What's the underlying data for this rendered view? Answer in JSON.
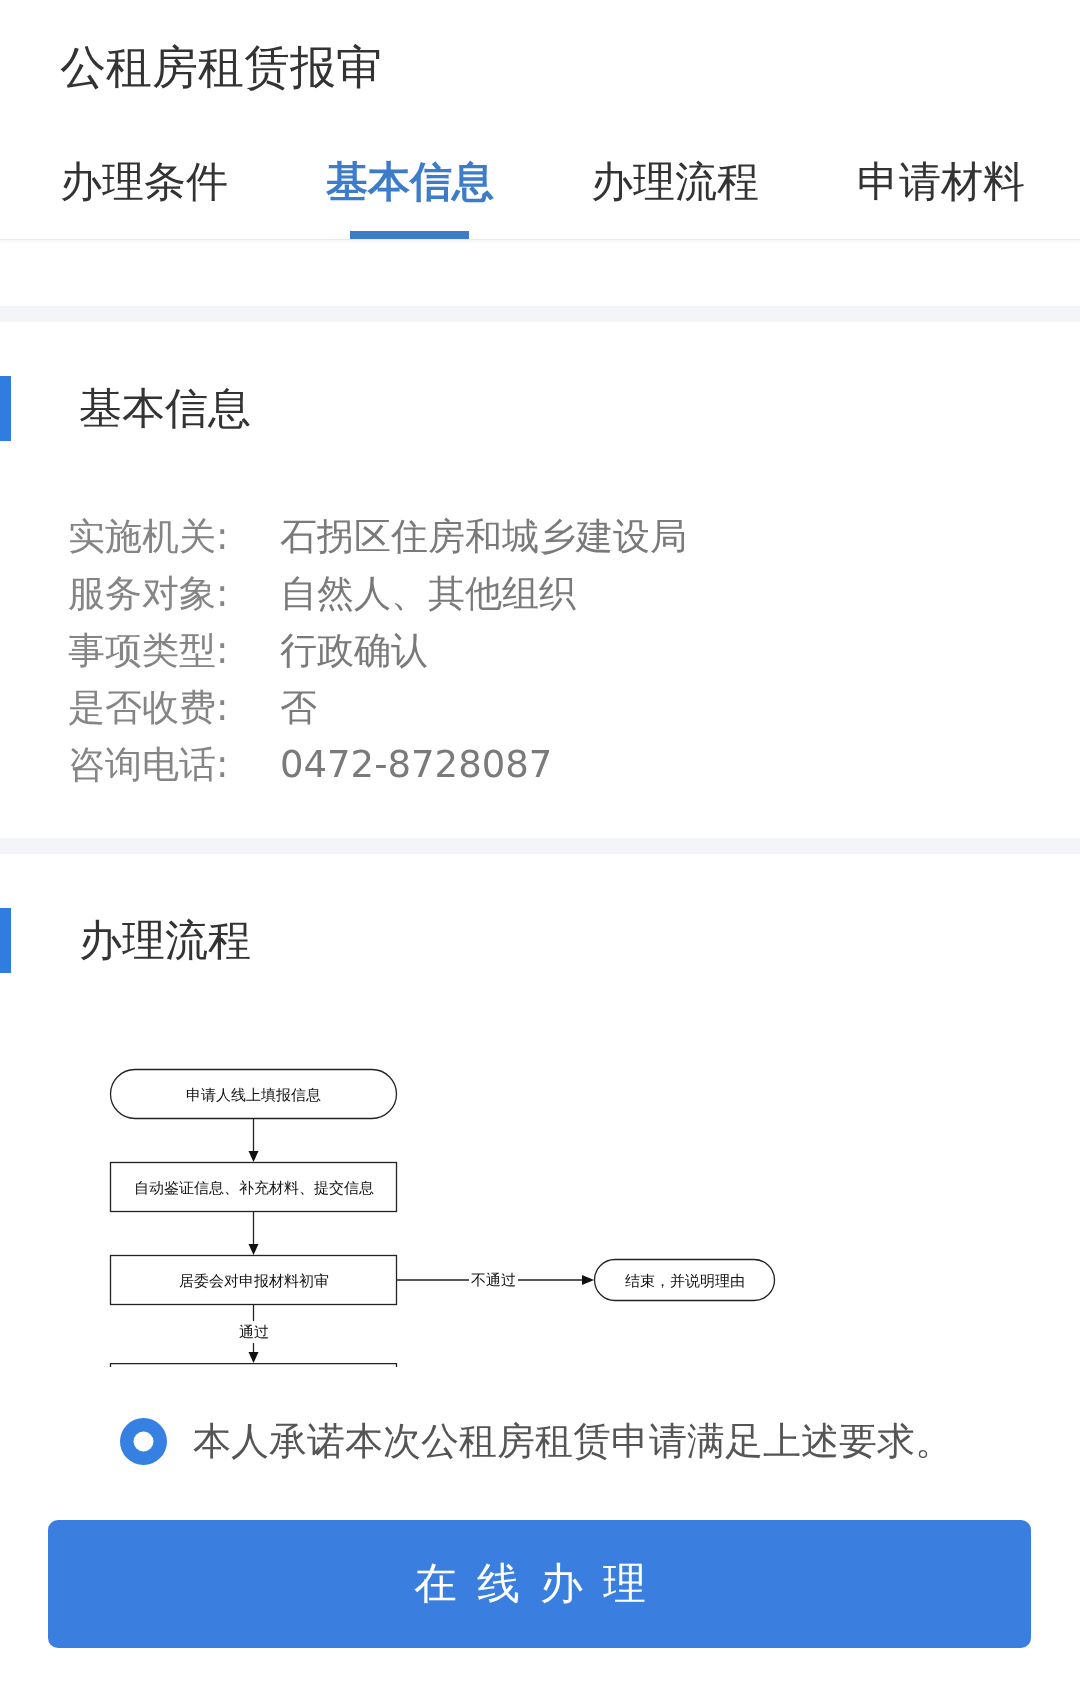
{
  "header": {
    "title": "公租房租赁报审"
  },
  "tabs": [
    {
      "label": "办理条件",
      "selected": false
    },
    {
      "label": "基本信息",
      "selected": true
    },
    {
      "label": "办理流程",
      "selected": false
    },
    {
      "label": "申请材料",
      "selected": false
    }
  ],
  "sections": [
    {
      "kind": "info",
      "title": "基本信息",
      "rows": [
        {
          "label": "实施机关:",
          "value": "石拐区住房和城乡建设局"
        },
        {
          "label": "服务对象:",
          "value": "自然人、其他组织"
        },
        {
          "label": "事项类型:",
          "value": "行政确认"
        },
        {
          "label": "是否收费:",
          "value": "否"
        },
        {
          "label": "咨询电话:",
          "value": "0472-8728087"
        }
      ]
    },
    {
      "kind": "flow",
      "title": "办理流程",
      "flowchart": {
        "steps": [
          {
            "kind": "terminal",
            "label": "申请人线上填报信息"
          },
          {
            "kind": "process",
            "label": "自动鉴证信息、补充材料、提交信息"
          },
          {
            "kind": "process",
            "label": "居委会对申报材料初审",
            "branch": {
              "arrow_label": "不通过",
              "node": {
                "kind": "terminal",
                "label": "结束，并说明理由"
              }
            }
          },
          {
            "kind": "process",
            "arrow_label": "通过"
          }
        ]
      }
    }
  ],
  "agreement": {
    "checked": true,
    "text": "本人承诺本次公租房租赁申请满足上述要求。"
  },
  "submit_button": {
    "label": "在线办理"
  }
}
